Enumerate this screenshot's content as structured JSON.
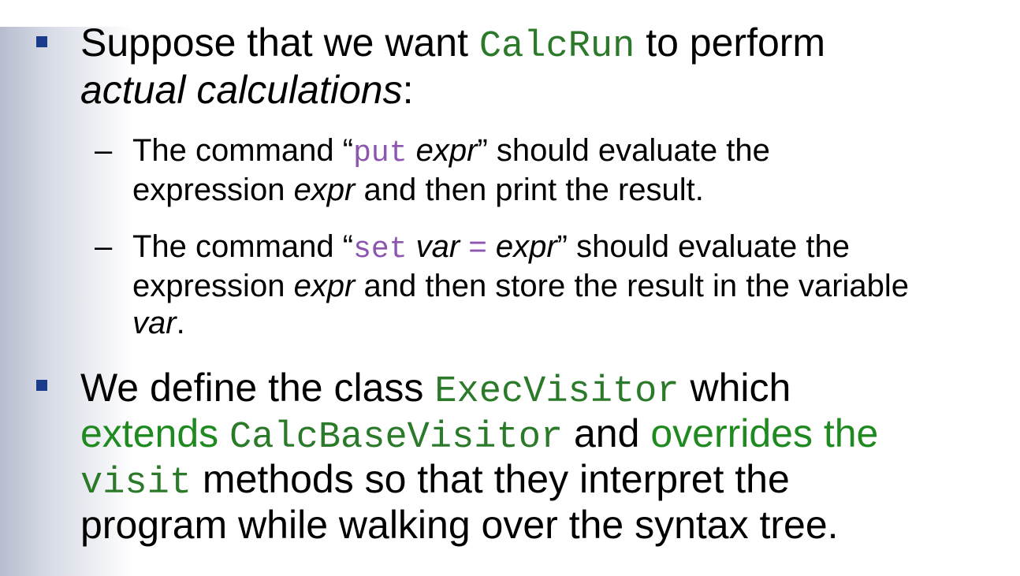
{
  "bullet1": {
    "pre": "Suppose that we want ",
    "code": "CalcRun",
    "post": " to perform",
    "line2_em": "actual calculations",
    "line2_post": ":"
  },
  "sub1": {
    "dash": "–",
    "pre": "The command “",
    "code": "put",
    "space": " ",
    "em": "expr",
    "post": "” should evaluate the",
    "line2_pre": "expression ",
    "line2_em": "expr",
    "line2_post": " and then print the result."
  },
  "sub2": {
    "dash": "–",
    "pre": "The command “",
    "code": "set",
    "space": " ",
    "em1": "var",
    "eq": " = ",
    "em2": "expr",
    "post": "” should evaluate the",
    "line2_pre": "expression ",
    "line2_em": "expr",
    "line2_post": " and then store the result in the variable",
    "line3_em": "var",
    "line3_post": "."
  },
  "bullet2": {
    "pre": "We define the class ",
    "code1": "ExecVisitor",
    "post1": " which",
    "extends": "extends",
    "space": " ",
    "code2": "CalcBaseVisitor",
    "and": " and ",
    "overrides": "overrides the",
    "code3": "visit",
    "line3_post": " methods so that they interpret the",
    "line4": "program while walking over the syntax tree."
  },
  "colors": {
    "bullet": "#1a3b8c",
    "code_green": "#2a7a2a",
    "code_purple": "#8b55b0",
    "highlight_green": "#1f8a1f"
  }
}
